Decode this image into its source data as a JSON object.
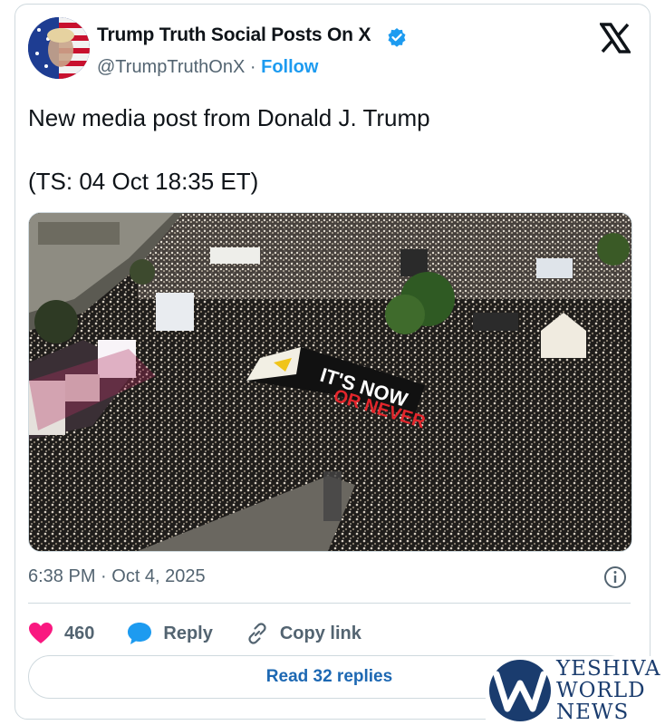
{
  "post": {
    "display_name": "Trump Truth Social Posts On X",
    "handle": "@TrumpTruthOnX",
    "separator": "·",
    "follow_label": "Follow",
    "text_line1": "New media post from Donald J. Trump",
    "text_line2": "(TS: 04 Oct 18:35 ET)",
    "banner_line1": "IT'S NOW",
    "banner_line2": "OR NEVER",
    "timestamp": "6:38 PM · Oct 4, 2025"
  },
  "actions": {
    "likes_count": "460",
    "reply_label": "Reply",
    "copy_link_label": "Copy link"
  },
  "read_replies_label": "Read 32 replies",
  "watermark": {
    "line1": "YESHIVA",
    "line2": "WORLD",
    "line3": "NEWS"
  },
  "colors": {
    "accent": "#1d9bf0",
    "like": "#f91880",
    "muted": "#536471",
    "watermark": "#1a3c6e"
  },
  "icons": {
    "verified": "verified-badge-icon",
    "x_logo": "x-logo-icon",
    "info": "info-icon",
    "like": "heart-icon",
    "reply": "speech-bubble-icon",
    "copy_link": "link-icon"
  }
}
